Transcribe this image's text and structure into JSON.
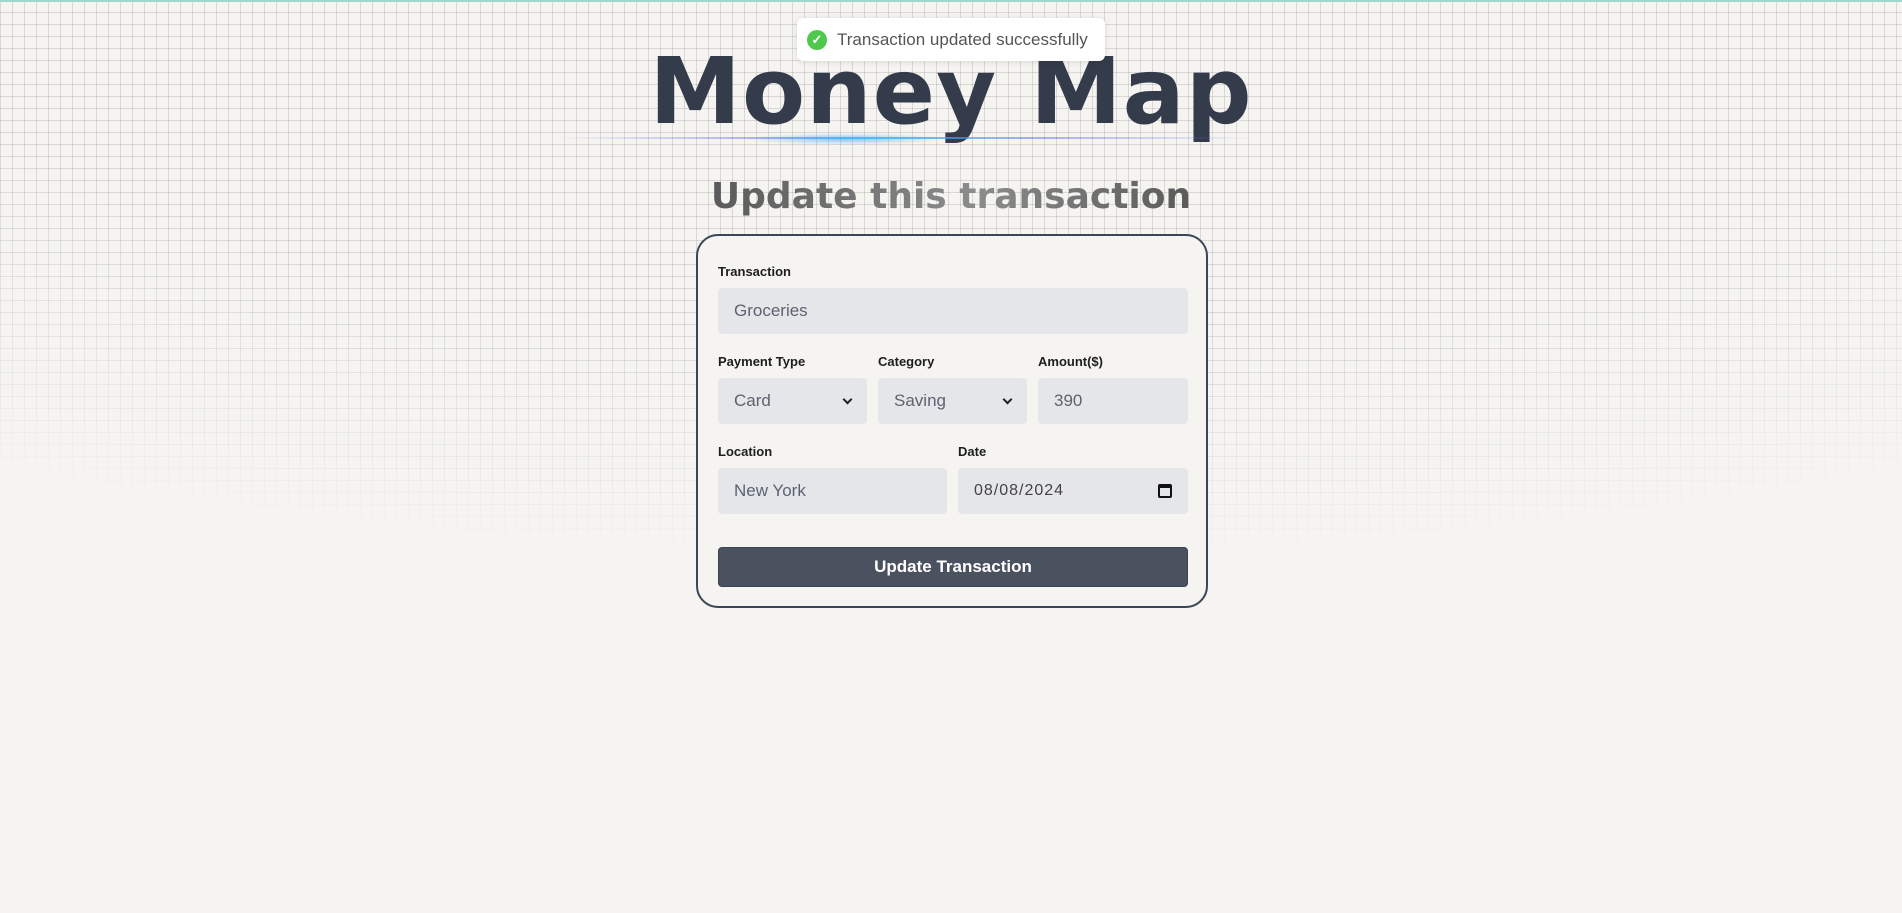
{
  "app": {
    "title": "Money Map",
    "subtitle": "Update this transaction"
  },
  "toast": {
    "message": "Transaction updated successfully",
    "icon": "check-circle-icon",
    "color": "#4ec94e"
  },
  "form": {
    "transaction": {
      "label": "Transaction",
      "value": "Groceries"
    },
    "payment_type": {
      "label": "Payment Type",
      "value": "Card"
    },
    "category": {
      "label": "Category",
      "value": "Saving"
    },
    "amount": {
      "label": "Amount($)",
      "value": "390"
    },
    "location": {
      "label": "Location",
      "value": "New York"
    },
    "date": {
      "label": "Date",
      "value": "08/08/2024"
    },
    "submit_label": "Update Transaction"
  },
  "colors": {
    "accent": "#4a5260",
    "title": "#343c4c",
    "border": "#3b4557"
  }
}
